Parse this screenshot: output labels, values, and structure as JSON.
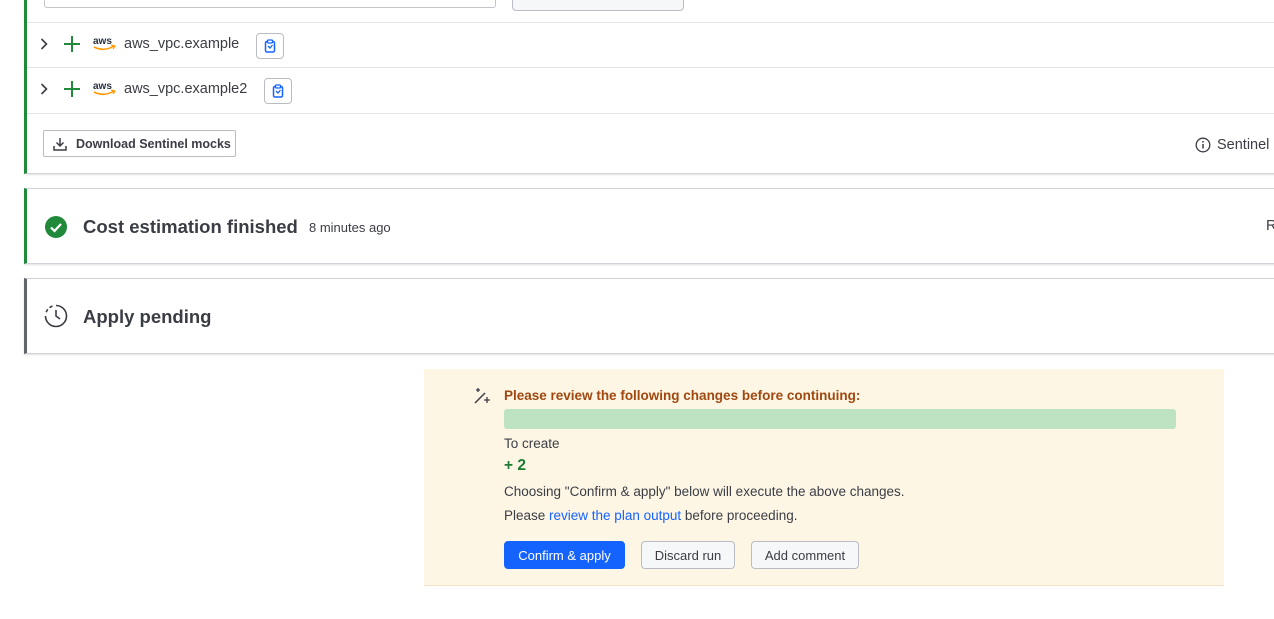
{
  "resources": {
    "items": [
      {
        "name": "aws_vpc.example",
        "provider": "aws",
        "action": "create"
      },
      {
        "name": "aws_vpc.example2",
        "provider": "aws",
        "action": "create"
      }
    ],
    "download_label": "Download Sentinel mocks",
    "sentinel_info_label": "Sentinel r"
  },
  "cost_estimation": {
    "title": "Cost estimation finished",
    "time": "8 minutes ago",
    "right_cut_text": "R"
  },
  "apply": {
    "title": "Apply pending"
  },
  "review": {
    "heading": "Please review the following changes before continuing:",
    "to_create_label": "To create",
    "to_create_count": "+ 2",
    "line1": "Choosing \"Confirm & apply\" below will execute the above changes.",
    "line2_prefix": "Please ",
    "line2_link": "review the plan output",
    "line2_suffix": " before proceeding.",
    "confirm_label": "Confirm & apply",
    "discard_label": "Discard run",
    "comment_label": "Add comment"
  },
  "colors": {
    "success": "#21893a",
    "primary": "#1563ff",
    "warning_bg": "#fef6e5",
    "warning_text": "#a0480f",
    "create_bar": "#bde3c2",
    "neutral_border": "#62646b"
  }
}
